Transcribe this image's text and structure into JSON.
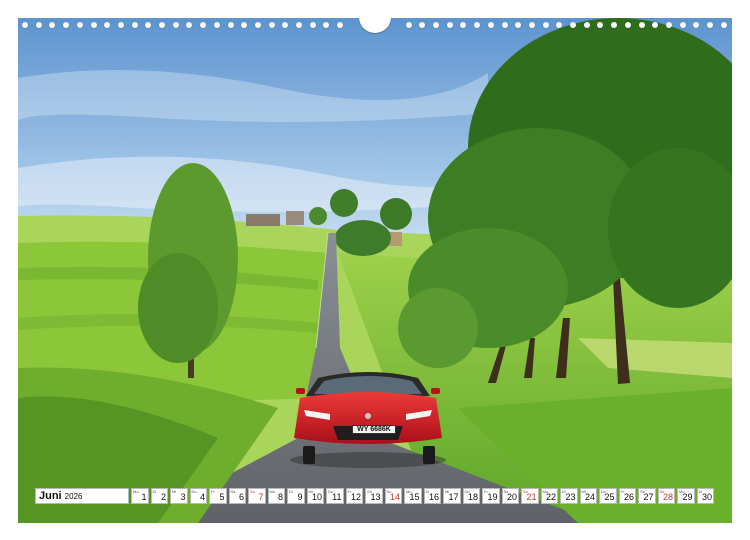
{
  "calendar": {
    "month": "Juni",
    "year": "2026",
    "days": [
      {
        "dow": "Mo",
        "num": "1",
        "sunday": false
      },
      {
        "dow": "Di",
        "num": "2",
        "sunday": false
      },
      {
        "dow": "Mi",
        "num": "3",
        "sunday": false
      },
      {
        "dow": "Do",
        "num": "4",
        "sunday": false
      },
      {
        "dow": "Fr",
        "num": "5",
        "sunday": false
      },
      {
        "dow": "Sa",
        "num": "6",
        "sunday": false
      },
      {
        "dow": "So",
        "num": "7",
        "sunday": true
      },
      {
        "dow": "Mo",
        "num": "8",
        "sunday": false
      },
      {
        "dow": "Di",
        "num": "9",
        "sunday": false
      },
      {
        "dow": "Mi",
        "num": "10",
        "sunday": false
      },
      {
        "dow": "Do",
        "num": "11",
        "sunday": false
      },
      {
        "dow": "Fr",
        "num": "12",
        "sunday": false
      },
      {
        "dow": "Sa",
        "num": "13",
        "sunday": false
      },
      {
        "dow": "So",
        "num": "14",
        "sunday": true
      },
      {
        "dow": "Mo",
        "num": "15",
        "sunday": false
      },
      {
        "dow": "Di",
        "num": "16",
        "sunday": false
      },
      {
        "dow": "Mi",
        "num": "17",
        "sunday": false
      },
      {
        "dow": "Do",
        "num": "18",
        "sunday": false
      },
      {
        "dow": "Fr",
        "num": "19",
        "sunday": false
      },
      {
        "dow": "Sa",
        "num": "20",
        "sunday": false
      },
      {
        "dow": "So",
        "num": "21",
        "sunday": true
      },
      {
        "dow": "Mo",
        "num": "22",
        "sunday": false
      },
      {
        "dow": "Di",
        "num": "23",
        "sunday": false
      },
      {
        "dow": "Mi",
        "num": "24",
        "sunday": false
      },
      {
        "dow": "Do",
        "num": "25",
        "sunday": false
      },
      {
        "dow": "Fr",
        "num": "26",
        "sunday": false
      },
      {
        "dow": "Sa",
        "num": "27",
        "sunday": false
      },
      {
        "dow": "So",
        "num": "28",
        "sunday": true
      },
      {
        "dow": "Mo",
        "num": "29",
        "sunday": false
      },
      {
        "dow": "Di",
        "num": "30",
        "sunday": false
      }
    ]
  },
  "photo": {
    "license_plate": "WY 6686K"
  },
  "colors": {
    "sunday": "#c0392b",
    "car": "#d01b1f",
    "grass": "#7fbf2e",
    "sky": "#6fa4d8"
  }
}
